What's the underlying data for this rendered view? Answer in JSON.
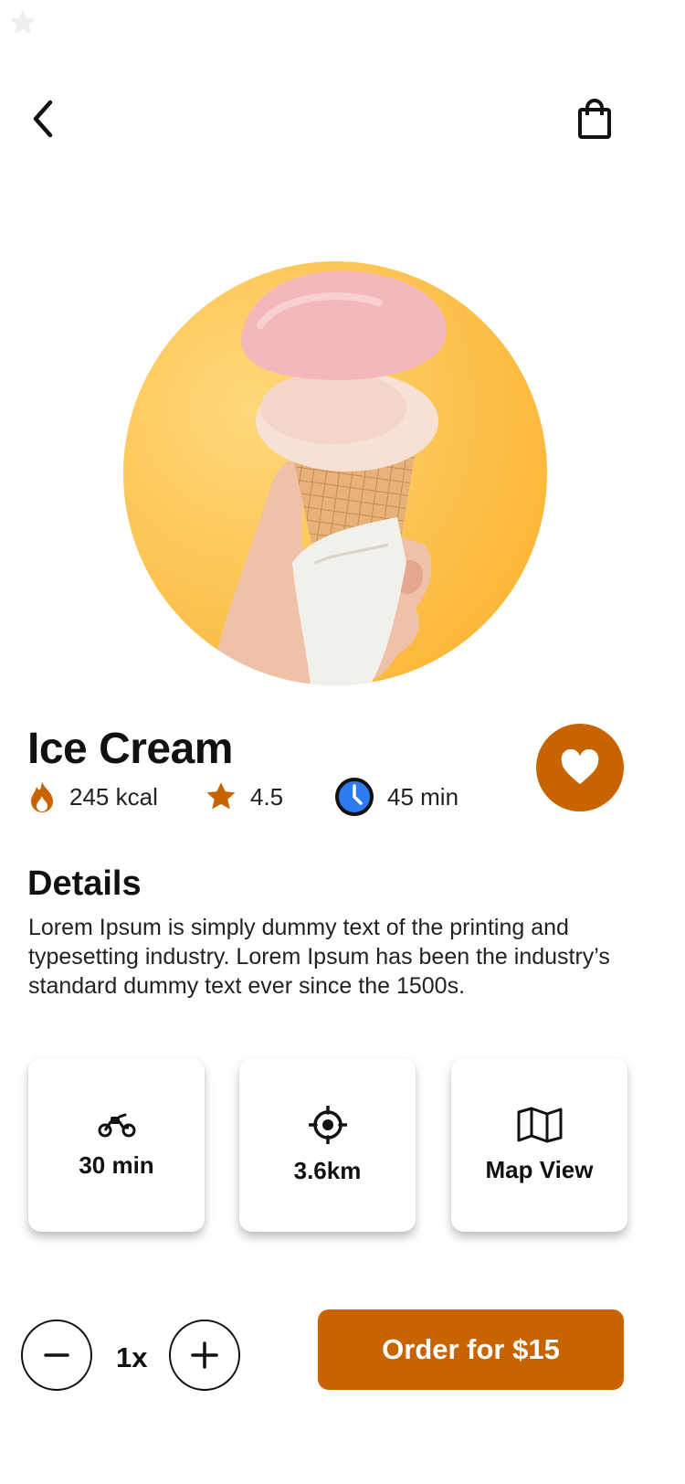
{
  "header": {
    "back_icon": "chevron-left-icon",
    "cart_icon": "shopping-bag-icon"
  },
  "product": {
    "name": "Ice Cream",
    "image_desc": "hand holding ice cream cone on orange background",
    "stats": {
      "calories": "245 kcal",
      "rating": "4.5",
      "time": "45 min"
    }
  },
  "details": {
    "heading": "Details",
    "text": "Lorem Ipsum is simply dummy text of the printing and typesetting industry. Lorem Ipsum has been the industry’s standard dummy text ever since the 1500s."
  },
  "info_cards": [
    {
      "icon": "motorbike-icon",
      "label": "30 min"
    },
    {
      "icon": "location-target-icon",
      "label": "3.6km"
    },
    {
      "icon": "map-icon",
      "label": "Map View"
    }
  ],
  "order": {
    "quantity": "1x",
    "button_label": "Order for $15"
  },
  "colors": {
    "accent": "#C86400",
    "image_bg": "#FBB535",
    "clock_blue": "#2D7BF0"
  }
}
